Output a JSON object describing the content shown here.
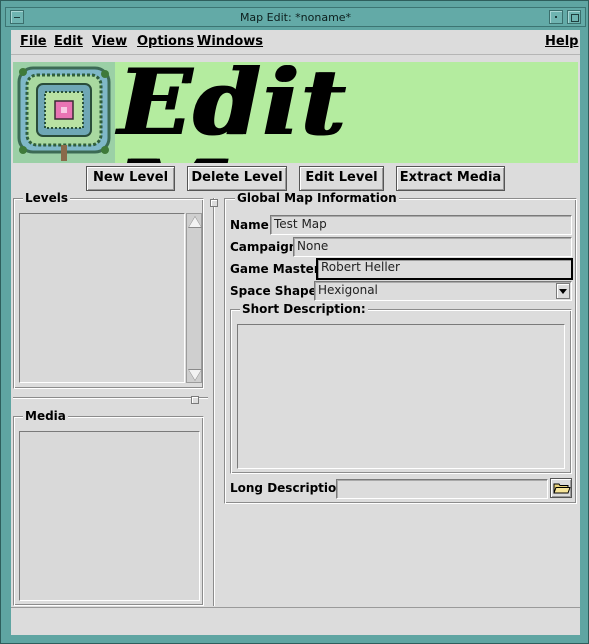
{
  "window": {
    "title": "Map Edit: *noname*"
  },
  "menubar": {
    "items": [
      "File",
      "Edit",
      "View",
      "Options",
      "Windows"
    ],
    "help": "Help"
  },
  "banner": {
    "title": "Edit Map",
    "background_color": "#b4ec9f"
  },
  "toolbar": {
    "new_level": "New Level",
    "delete_level": "Delete Level",
    "edit_level": "Edit Level",
    "extract_media": "Extract Media"
  },
  "levels": {
    "label": "Levels"
  },
  "media": {
    "label": "Media"
  },
  "global_info": {
    "label": "Global Map Information",
    "name_label": "Name:",
    "name_value": "Test Map",
    "campaign_label": "Campaign:",
    "campaign_value": "None",
    "game_master_label": "Game Master:",
    "game_master_value": "Robert Heller",
    "space_shape_label": "Space Shape:",
    "space_shape_value": "Hexigonal",
    "short_description_label": "Short Description:",
    "long_description_label": "Long Description:",
    "long_description_value": ""
  },
  "icons": {
    "window_menu": "window-menu-icon",
    "minimize": "minimize-icon",
    "maximize": "maximize-icon",
    "folder": "folder-icon",
    "scroll_up": "scroll-up-arrow-icon",
    "scroll_down": "scroll-down-arrow-icon",
    "dropdown": "dropdown-arrow-icon"
  }
}
